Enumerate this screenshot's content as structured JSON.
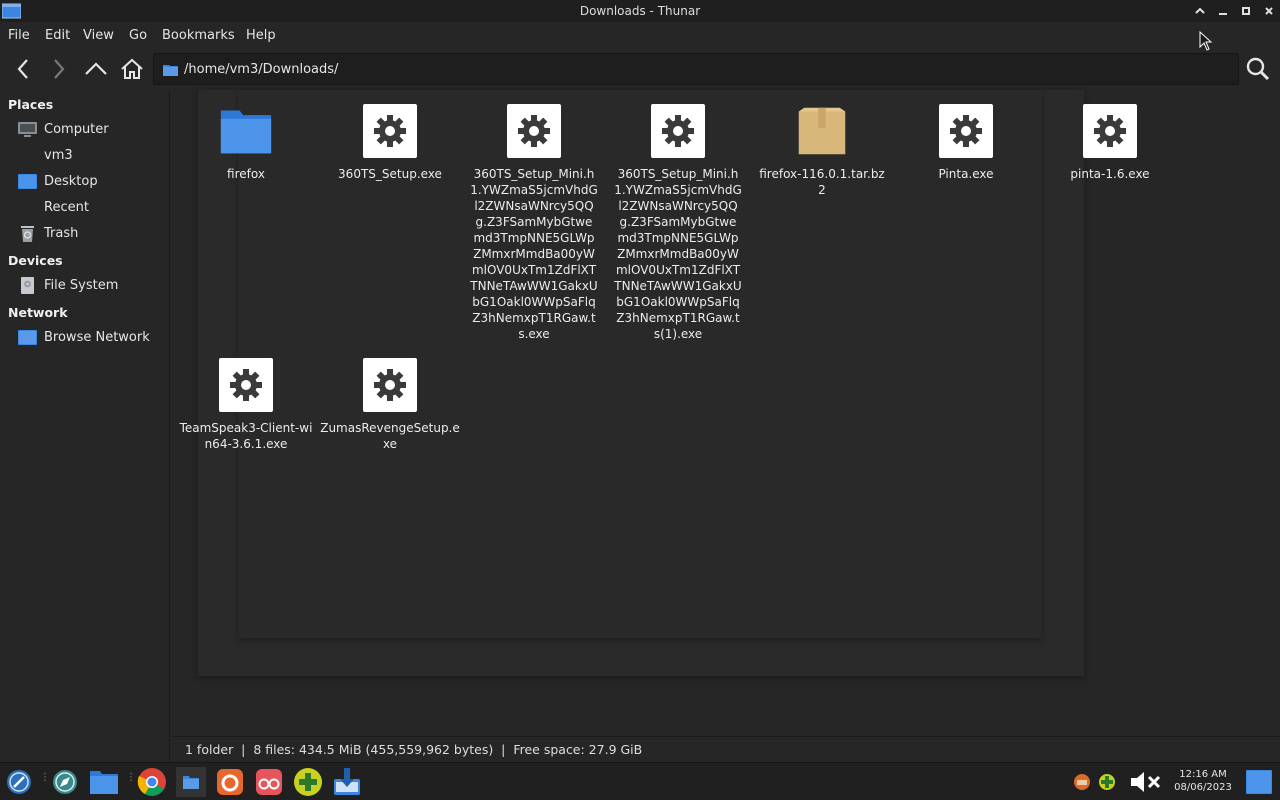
{
  "window": {
    "title": "Downloads - Thunar"
  },
  "menu": [
    "File",
    "Edit",
    "View",
    "Go",
    "Bookmarks",
    "Help"
  ],
  "location": {
    "path": "/home/vm3/Downloads/"
  },
  "sidebar": {
    "places_header": "Places",
    "places": [
      {
        "label": "Computer",
        "icon": "computer-icon"
      },
      {
        "label": "vm3",
        "icon": "home-folder-icon"
      },
      {
        "label": "Desktop",
        "icon": "desktop-icon"
      },
      {
        "label": "Recent",
        "icon": "recent-icon"
      },
      {
        "label": "Trash",
        "icon": "trash-icon"
      }
    ],
    "devices_header": "Devices",
    "devices": [
      {
        "label": "File System",
        "icon": "drive-icon"
      }
    ],
    "network_header": "Network",
    "network": [
      {
        "label": "Browse Network",
        "icon": "network-icon"
      }
    ]
  },
  "files": [
    {
      "name": "firefox",
      "icon": "folder-icon"
    },
    {
      "name": "360TS_Setup.exe",
      "icon": "executable-gear-icon"
    },
    {
      "name": "360TS_Setup_Mini.h1.YWZmaS5jcmVhdGl2ZWNsaWNrcy5QQg.Z3FSamMybGtwemd3TmpNNE5GLWpZMmxrMmdBa00yWmlOV0UxTm1ZdFlXTTNNeTAwWW1GakxUbG1Oakl0WWpSaFlqZ3hNemxpT1RGaw.ts.exe",
      "icon": "executable-gear-icon"
    },
    {
      "name": "360TS_Setup_Mini.h1.YWZmaS5jcmVhdGl2ZWNsaWNrcy5QQg.Z3FSamMybGtwemd3TmpNNE5GLWpZMmxrMmdBa00yWmlOV0UxTm1ZdFlXTTNNeTAwWW1GakxUbG1Oakl0WWpSaFlqZ3hNemxpT1RGaw.ts(1).exe",
      "icon": "executable-gear-icon"
    },
    {
      "name": "firefox-116.0.1.tar.bz2",
      "icon": "archive-package-icon"
    },
    {
      "name": "Pinta.exe",
      "icon": "executable-gear-icon"
    },
    {
      "name": "pinta-1.6.exe",
      "icon": "executable-gear-icon"
    },
    {
      "name": "TeamSpeak3-Client-win64-3.6.1.exe",
      "icon": "executable-gear-icon"
    },
    {
      "name": "ZumasRevengeSetup.exe",
      "icon": "executable-gear-icon"
    }
  ],
  "status": {
    "text": "1 folder  |  8 files: 434.5 MiB (455,559,962 bytes)  |  Free space: 27.9 GiB"
  },
  "clock": {
    "time": "12:16 AM",
    "date": "08/06/2023"
  },
  "colors": {
    "accent": "#3b86e0",
    "background": "#262626"
  }
}
